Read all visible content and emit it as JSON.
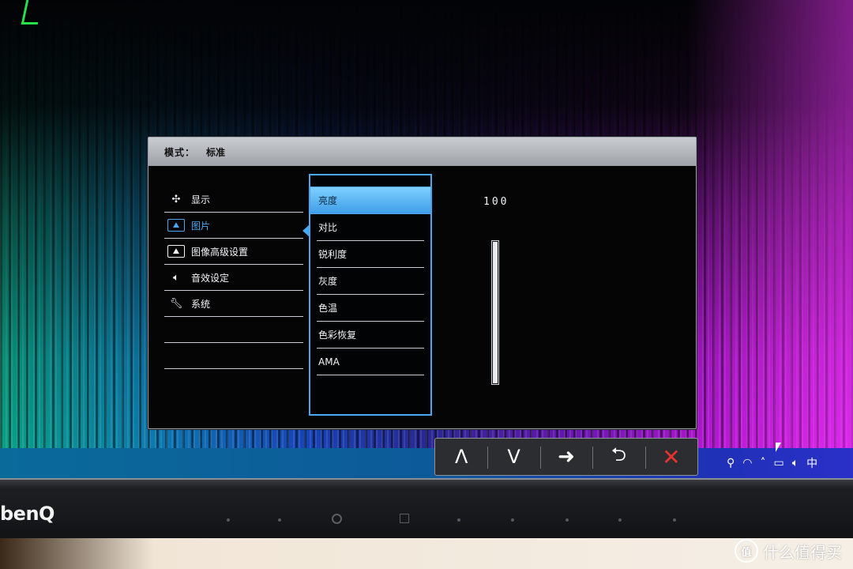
{
  "osd": {
    "header": {
      "mode_label": "模式：",
      "mode_value": "标准"
    },
    "main_menu": [
      {
        "label": "显示",
        "icon": "display-icon",
        "active": false
      },
      {
        "label": "图片",
        "icon": "picture-icon",
        "active": true
      },
      {
        "label": "图像高级设置",
        "icon": "picture-advanced-icon",
        "active": false
      },
      {
        "label": "音效设定",
        "icon": "speaker-icon",
        "active": false
      },
      {
        "label": "系统",
        "icon": "wrench-icon",
        "active": false
      },
      {
        "label": "",
        "icon": "",
        "active": false
      },
      {
        "label": "",
        "icon": "",
        "active": false
      }
    ],
    "picture_submenu": [
      {
        "label": "亮度",
        "selected": true
      },
      {
        "label": "对比",
        "selected": false
      },
      {
        "label": "锐利度",
        "selected": false
      },
      {
        "label": "灰度",
        "selected": false
      },
      {
        "label": "色温",
        "selected": false
      },
      {
        "label": "色彩恢复",
        "selected": false
      },
      {
        "label": "AMA",
        "selected": false
      }
    ],
    "brightness": {
      "value_text": "100",
      "level_fraction": 1.0
    },
    "accent_color": "#4aa8f2"
  },
  "hotkeys": [
    {
      "name": "up-button",
      "glyph": "Λ"
    },
    {
      "name": "down-button",
      "glyph": "V"
    },
    {
      "name": "enter-button",
      "glyph": "➜"
    },
    {
      "name": "back-button",
      "glyph": "⮌"
    },
    {
      "name": "exit-button",
      "glyph": "✕"
    }
  ],
  "taskbar": {
    "tray_icons": [
      "people-icon",
      "wifi-icon",
      "chevron-up-icon",
      "network-icon",
      "volume-icon"
    ],
    "ime_label": "中"
  },
  "bezel": {
    "brand": "benQ"
  },
  "watermark": {
    "logo": "值",
    "text": "什么值得买"
  }
}
